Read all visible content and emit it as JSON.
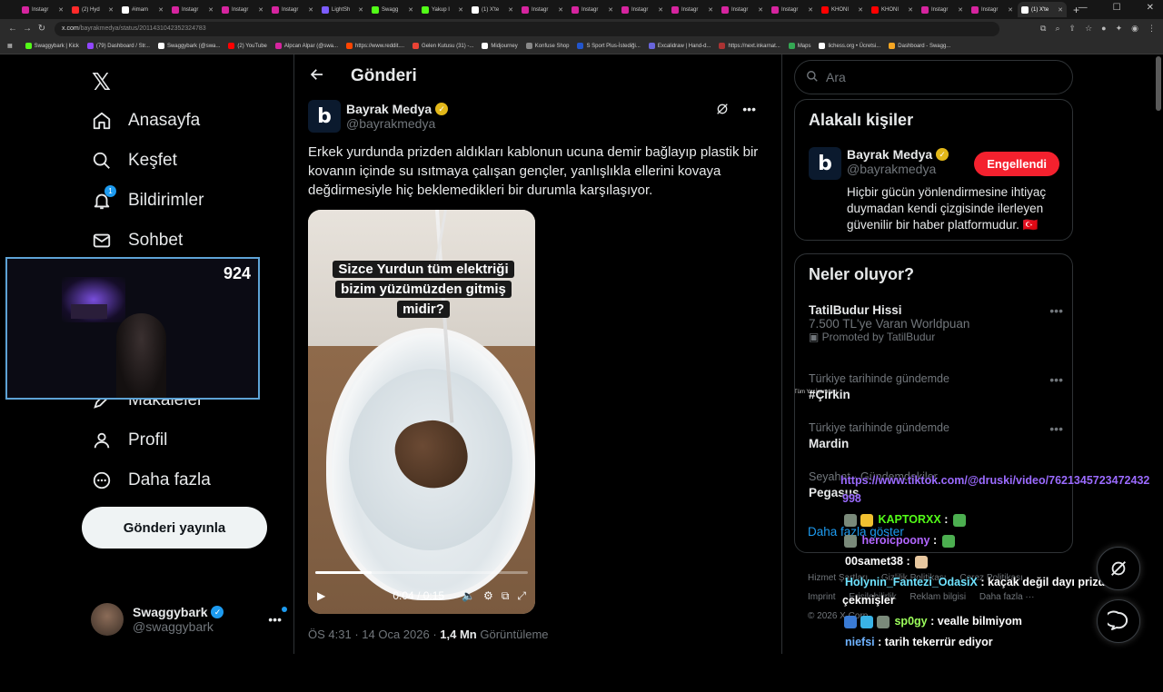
{
  "browser": {
    "tabs": [
      {
        "label": "Instagr",
        "color": "#d6249f"
      },
      {
        "label": "(2) Hyd",
        "color": "#ff2a2a"
      },
      {
        "label": "#imam",
        "color": "#ffffff"
      },
      {
        "label": "Instagr",
        "color": "#d6249f"
      },
      {
        "label": "Instagr",
        "color": "#d6249f"
      },
      {
        "label": "Instagr",
        "color": "#d6249f"
      },
      {
        "label": "LightSh",
        "color": "#7c5cff"
      },
      {
        "label": "Swagg",
        "color": "#53fc18"
      },
      {
        "label": "Yakup I",
        "color": "#53fc18"
      },
      {
        "label": "(1) X'te",
        "color": "#ffffff"
      },
      {
        "label": "Instagr",
        "color": "#d6249f"
      },
      {
        "label": "Instagr",
        "color": "#d6249f"
      },
      {
        "label": "Instagr",
        "color": "#d6249f"
      },
      {
        "label": "Instagr",
        "color": "#d6249f"
      },
      {
        "label": "Instagr",
        "color": "#d6249f"
      },
      {
        "label": "Instagr",
        "color": "#d6249f"
      },
      {
        "label": "KHONI",
        "color": "#ff0000"
      },
      {
        "label": "KHONI",
        "color": "#ff0000"
      },
      {
        "label": "Instagr",
        "color": "#d6249f"
      },
      {
        "label": "Instagr",
        "color": "#d6249f"
      },
      {
        "label": "(1) X'te",
        "color": "#ffffff"
      }
    ],
    "active_tab_index": 20,
    "url_domain": "x.com",
    "url_path": "/bayrakmedya/status/2011431042352324783",
    "bookmarks": [
      {
        "label": "Swaggybark | Kick",
        "color": "#53fc18"
      },
      {
        "label": "(79) Dashboard / Str...",
        "color": "#9146ff"
      },
      {
        "label": "Swaggybark (@swa...",
        "color": "#ffffff"
      },
      {
        "label": "(2) YouTube",
        "color": "#ff0000"
      },
      {
        "label": "Alpcan Alpar (@swa...",
        "color": "#d6249f"
      },
      {
        "label": "https://www.reddit....",
        "color": "#ff4500"
      },
      {
        "label": "Gelen Kutusu (31) -...",
        "color": "#ea4335"
      },
      {
        "label": "Midjourney",
        "color": "#ffffff"
      },
      {
        "label": "Konfuse Shop",
        "color": "#888888"
      },
      {
        "label": "S Sport Plus-İstediği...",
        "color": "#2255cc"
      },
      {
        "label": "Excalidraw | Hand-d...",
        "color": "#6965db"
      },
      {
        "label": "https://next.inkarnat...",
        "color": "#aa3333"
      },
      {
        "label": "Maps",
        "color": "#34a853"
      },
      {
        "label": "lichess.org • Ücretsi...",
        "color": "#ffffff"
      },
      {
        "label": "Dashboard - Swagg...",
        "color": "#f5a623"
      }
    ],
    "bookmarks_right": "Tüm Yer İşaretleri"
  },
  "nav": {
    "items": [
      {
        "label": "Anasayfa",
        "icon": "home-icon"
      },
      {
        "label": "Keşfet",
        "icon": "search-icon"
      },
      {
        "label": "Bildirimler",
        "icon": "bell-icon",
        "badge": "1"
      },
      {
        "label": "Sohbet",
        "icon": "mail-icon"
      },
      {
        "label": "Makaleler",
        "icon": "article-icon"
      },
      {
        "label": "Profil",
        "icon": "person-icon"
      },
      {
        "label": "Daha fazla",
        "icon": "more-circle-icon"
      }
    ],
    "post_button": "Gönderi yayınla",
    "account": {
      "name": "Swaggybark",
      "handle": "@swaggybark"
    }
  },
  "webcam": {
    "viewer_count": "924"
  },
  "post": {
    "header_title": "Gönderi",
    "author_name": "Bayrak Medya",
    "author_handle": "@bayrakmedya",
    "text": "Erkek yurdunda prizden aldıkları kablonun ucuna demir bağlayıp plastik bir kovanın içinde su ısıtmaya çalışan gençler, yanlışlıkla ellerini kovaya değdirmesiyle hiç beklemedikleri bir durumla karşılaşıyor.",
    "video_caption_lines": [
      "Sizce Yurdun tüm elektriği",
      "bizim yüzümüzden gitmiş",
      "midir?"
    ],
    "video_time": "0:04 / 0:15",
    "video_progress": 0.267,
    "time": "ÖS 4:31",
    "date": "14 Oca 2026",
    "views_value": "1,4 Mn",
    "views_label": "Görüntüleme"
  },
  "right": {
    "search_placeholder": "Ara",
    "related_title": "Alakalı kişiler",
    "related": {
      "name": "Bayrak Medya",
      "handle": "@bayrakmedya",
      "button": "Engellendi",
      "bio": "Hiçbir gücün yönlendirmesine ihtiyaç duymadan kendi çizgisinde ilerleyen güvenilir bir haber platformudur. 🇹🇷"
    },
    "trends_title": "Neler oluyor?",
    "trends": [
      {
        "context": "",
        "name": "TatilBudur Hissi",
        "sub": "7.500 TL'ye Varan Worldpuan",
        "promo": "Promoted by TatilBudur"
      },
      {
        "context": "Türkiye tarihinde gündemde",
        "name": "#Çirkin"
      },
      {
        "context": "Türkiye tarihinde gündemde",
        "name": "Mardin"
      },
      {
        "context": "Seyahat · Gündemdekiler",
        "name": "Pegasus"
      }
    ],
    "show_more": "Daha fazla göster",
    "footer": [
      "Hizmet Şartları",
      "Gizlilik Politikası",
      "Çerez Politikası",
      "Imprint",
      "Erişilebilirlik",
      "Reklam bilgisi",
      "Daha fazla ···",
      "© 2026 X Corp."
    ]
  },
  "chat": {
    "messages": [
      {
        "user": "",
        "user_color": "#ffffff",
        "text": "https://www.tiktok.com/@druski/video/7621345723472432",
        "text_color": "#9b6bff"
      },
      {
        "user": "",
        "user_color": "#ffffff",
        "text": "998",
        "text_color": "#9b6bff"
      },
      {
        "user": "KAPTORXX",
        "user_color": "#53fc18",
        "text": ":",
        "text_color": "#ffffff"
      },
      {
        "user": "heroicpoony",
        "user_color": "#b266ff",
        "text": ":",
        "text_color": "#ffffff"
      },
      {
        "user": "00samet38",
        "user_color": "#ffffff",
        "text": ":",
        "text_color": "#ffffff"
      },
      {
        "user": "Holynin_Fantezi_OdasiX",
        "user_color": "#6fe3ff",
        "text": ": kaçak değil dayı prizden",
        "text_color": "#ffffff"
      },
      {
        "user": "",
        "user_color": "#ffffff",
        "text": "çekmişler",
        "text_color": "#ffffff"
      },
      {
        "user": "sp0gy",
        "user_color": "#9dff5c",
        "text": ": vealle bilmiyom",
        "text_color": "#ffffff"
      },
      {
        "user": "niefsi",
        "user_color": "#6fb3ff",
        "text": ": tarih tekerrür ediyor",
        "text_color": "#ffffff"
      }
    ]
  },
  "colors": {
    "accent": "#1d9bf0",
    "blocked": "#f4212e",
    "verified": "#e2b719"
  }
}
